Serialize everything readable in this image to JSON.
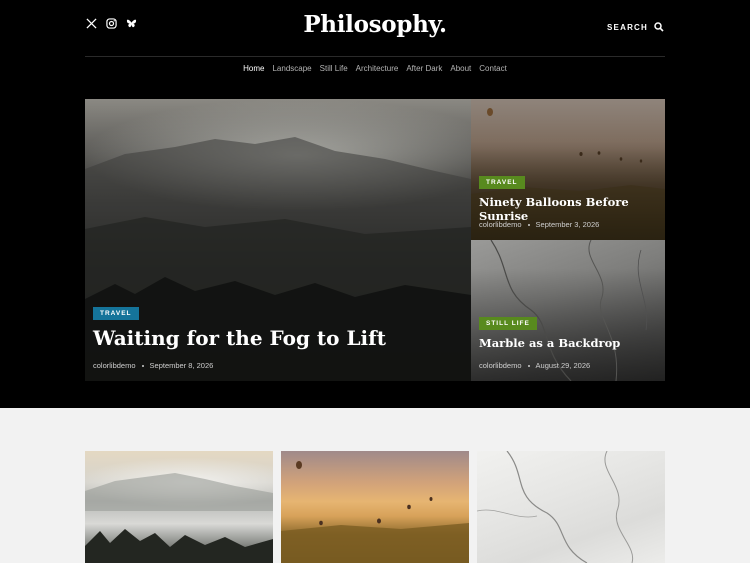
{
  "site": {
    "logo": "Philosophy."
  },
  "header": {
    "social": [
      "x-icon",
      "instagram-icon",
      "bluesky-icon"
    ],
    "search_label": "SEARCH"
  },
  "nav": {
    "items": [
      "Home",
      "Landscape",
      "Still Life",
      "Architecture",
      "After Dark",
      "About",
      "Contact"
    ],
    "active": "Home"
  },
  "featured": {
    "main": {
      "category": "TRAVEL",
      "title": "Waiting for the Fog to Lift",
      "author": "colorlibdemo",
      "date": "September 8, 2026"
    },
    "side": [
      {
        "category": "TRAVEL",
        "title": "Ninety Balloons Before Sunrise",
        "author": "colorlibdemo",
        "date": "September 3, 2026"
      },
      {
        "category": "STILL LIFE",
        "title": "Marble as a Backdrop",
        "author": "colorlibdemo",
        "date": "August 29, 2026"
      }
    ]
  },
  "colors": {
    "travel_badge": "#15749a",
    "still_life_badge": "#588a1e",
    "header_bg": "#000000",
    "page_bg": "#f2f2f2"
  }
}
